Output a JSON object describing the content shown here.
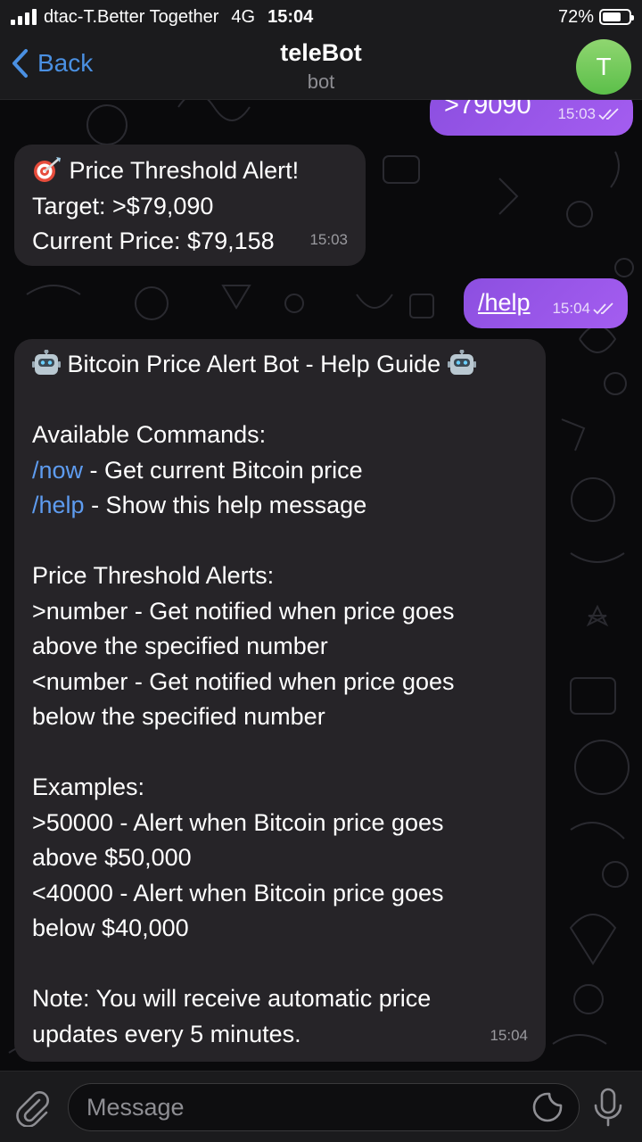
{
  "status_bar": {
    "carrier": "dtac-T.Better Together",
    "network": "4G",
    "time": "15:04",
    "battery_percent": "72%",
    "battery_level": 0.72
  },
  "header": {
    "back_label": "Back",
    "title": "teleBot",
    "subtitle": "bot",
    "avatar_letter": "T",
    "avatar_color": "#6cc857",
    "accent_color": "#4a90e2"
  },
  "messages": [
    {
      "direction": "outgoing",
      "text": ">79090",
      "time": "15:03",
      "status_icon": "double-check-icon"
    },
    {
      "direction": "incoming",
      "lines": [
        "Price Threshold Alert!",
        "Target: >$79,090",
        "Current Price: $79,158"
      ],
      "icon": "target-dart-icon",
      "time": "15:03"
    },
    {
      "direction": "outgoing",
      "text": "/help",
      "time": "15:04",
      "status_icon": "double-check-icon"
    },
    {
      "direction": "incoming",
      "title": "Bitcoin Price Alert Bot - Help Guide",
      "title_icon": "robot-icon",
      "commands_heading": "Available Commands:",
      "commands": [
        {
          "command": "/now",
          "description": " - Get current Bitcoin price"
        },
        {
          "command": "/help",
          "description": " - Show this help message"
        }
      ],
      "alerts_heading": "Price Threshold Alerts:",
      "alerts_lines": [
        ">number - Get notified when price goes",
        "above the specified number",
        "<number - Get notified when price goes",
        "below the specified number"
      ],
      "examples_heading": "Examples:",
      "examples_lines": [
        ">50000 - Alert when Bitcoin price goes",
        "above $50,000",
        "<40000 - Alert when Bitcoin price goes",
        "below $40,000"
      ],
      "note_lines": [
        "Note: You will receive automatic price",
        "updates every 5 minutes."
      ],
      "time": "15:04"
    }
  ],
  "input": {
    "placeholder": "Message",
    "value": ""
  },
  "colors": {
    "outgoing_bubble": "#9b57ec",
    "incoming_bubble": "#262428",
    "command_link": "#5e9cf0",
    "bar_background": "#1b1b1d"
  }
}
